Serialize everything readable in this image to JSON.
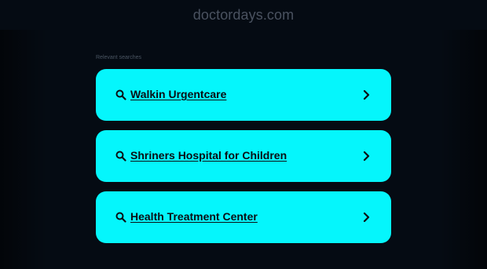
{
  "header": {
    "domain": "doctordays.com"
  },
  "section": {
    "label": "Relevant searches"
  },
  "searches": [
    {
      "label": "Walkin Urgentcare"
    },
    {
      "label": "Shriners Hospital for Children"
    },
    {
      "label": "Health Treatment Center"
    }
  ],
  "colors": {
    "background": "#050b13",
    "card": "#05f6fc",
    "text_dark": "#0b0f14",
    "muted": "#4a5260"
  },
  "icons": {
    "search": "search-icon",
    "chevron": "chevron-right-icon"
  }
}
